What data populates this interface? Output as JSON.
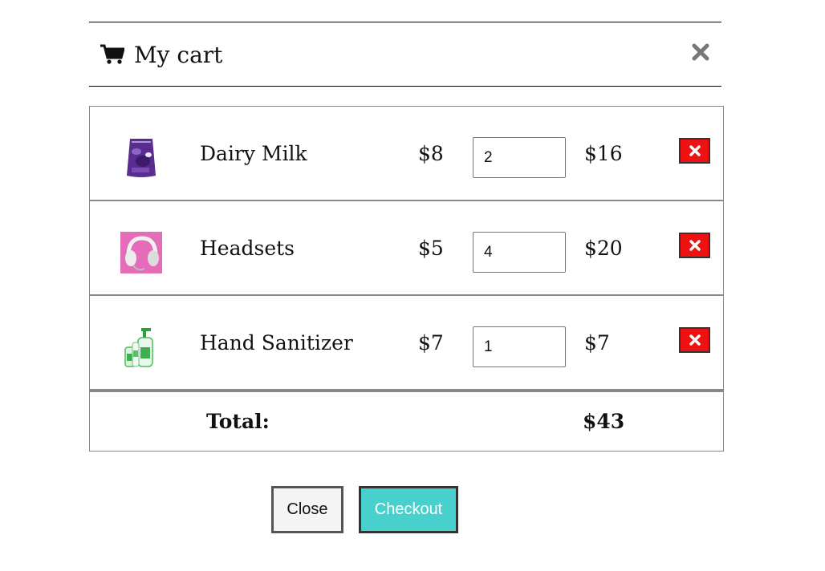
{
  "header": {
    "title": "My cart",
    "cart_icon": "shopping-cart-icon",
    "close_icon": "close-x-icon"
  },
  "items": [
    {
      "name": "Dairy Milk",
      "price": "$8",
      "quantity": "2",
      "subtotal": "$16",
      "image": "chocolate-bag"
    },
    {
      "name": "Headsets",
      "price": "$5",
      "quantity": "4",
      "subtotal": "$20",
      "image": "headphones"
    },
    {
      "name": "Hand Sanitizer",
      "price": "$7",
      "quantity": "1",
      "subtotal": "$7",
      "image": "sanitizer-bottles"
    }
  ],
  "total": {
    "label": "Total:",
    "value": "$43"
  },
  "buttons": {
    "close_label": "Close",
    "checkout_label": "Checkout"
  },
  "colors": {
    "remove_bg": "#ee1111",
    "checkout_bg": "#48d1cc"
  }
}
